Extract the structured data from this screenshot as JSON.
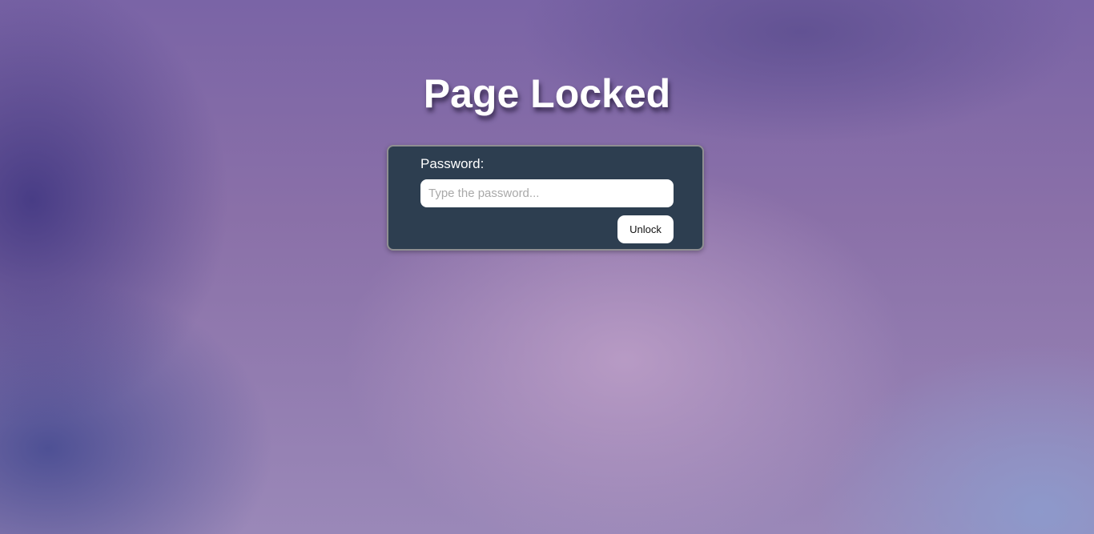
{
  "title": "Page Locked",
  "form": {
    "password_label": "Password:",
    "password_placeholder": "Type the password...",
    "password_value": "",
    "unlock_label": "Unlock"
  }
}
